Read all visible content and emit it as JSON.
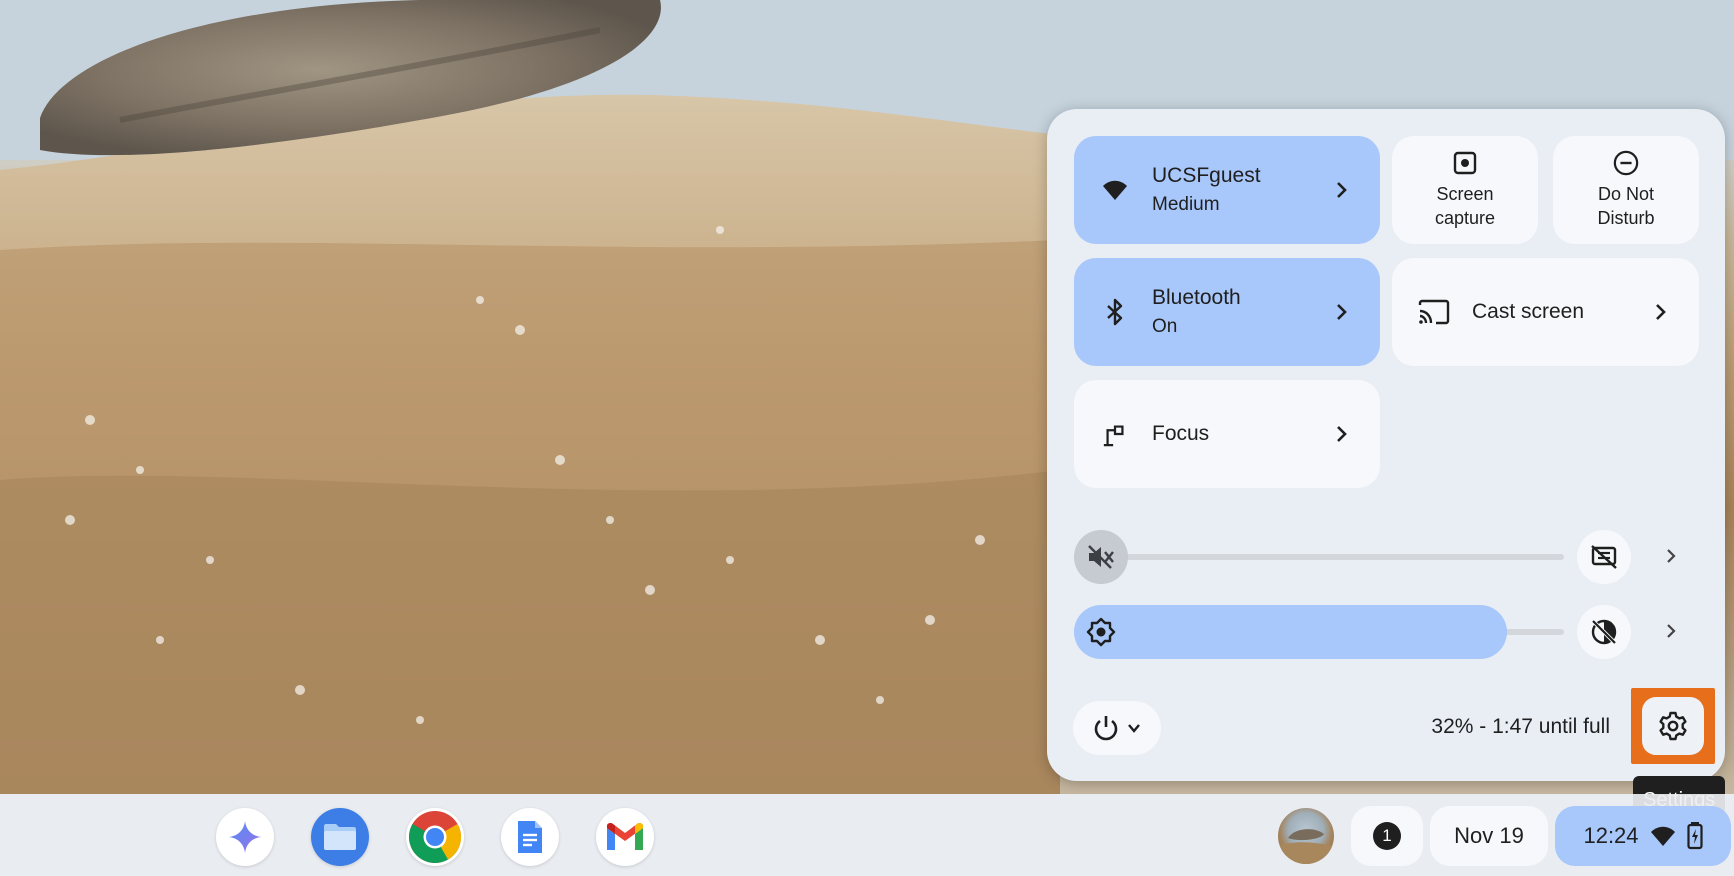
{
  "quick_settings": {
    "network": {
      "name": "UCSFguest",
      "status": "Medium",
      "icon": "wifi-icon"
    },
    "screen_capture": {
      "label_line1": "Screen",
      "label_line2": "capture",
      "icon": "screen-capture-icon"
    },
    "do_not_disturb": {
      "label_line1": "Do Not",
      "label_line2": "Disturb",
      "icon": "do-not-disturb-icon"
    },
    "bluetooth": {
      "name": "Bluetooth",
      "status": "On",
      "icon": "bluetooth-icon"
    },
    "cast": {
      "label": "Cast screen",
      "icon": "cast-icon"
    },
    "focus": {
      "label": "Focus",
      "icon": "focus-icon"
    },
    "volume": {
      "muted": true,
      "level": 0,
      "icon": "volume-muted-icon"
    },
    "brightness": {
      "level": 0.87,
      "icon": "brightness-icon"
    },
    "battery_text": "32% - 1:47 until full",
    "settings_tooltip": "Settings",
    "accent_color": "#a8c7fa",
    "highlight_color": "#e76f1c"
  },
  "shelf": {
    "apps": [
      {
        "name": "Gemini",
        "icon": "gemini-icon"
      },
      {
        "name": "Files",
        "icon": "files-icon"
      },
      {
        "name": "Chrome",
        "icon": "chrome-icon"
      },
      {
        "name": "Docs",
        "icon": "docs-icon"
      },
      {
        "name": "Gmail",
        "icon": "gmail-icon"
      }
    ],
    "notification_count": "1",
    "date": "Nov 19",
    "time": "12:24"
  }
}
